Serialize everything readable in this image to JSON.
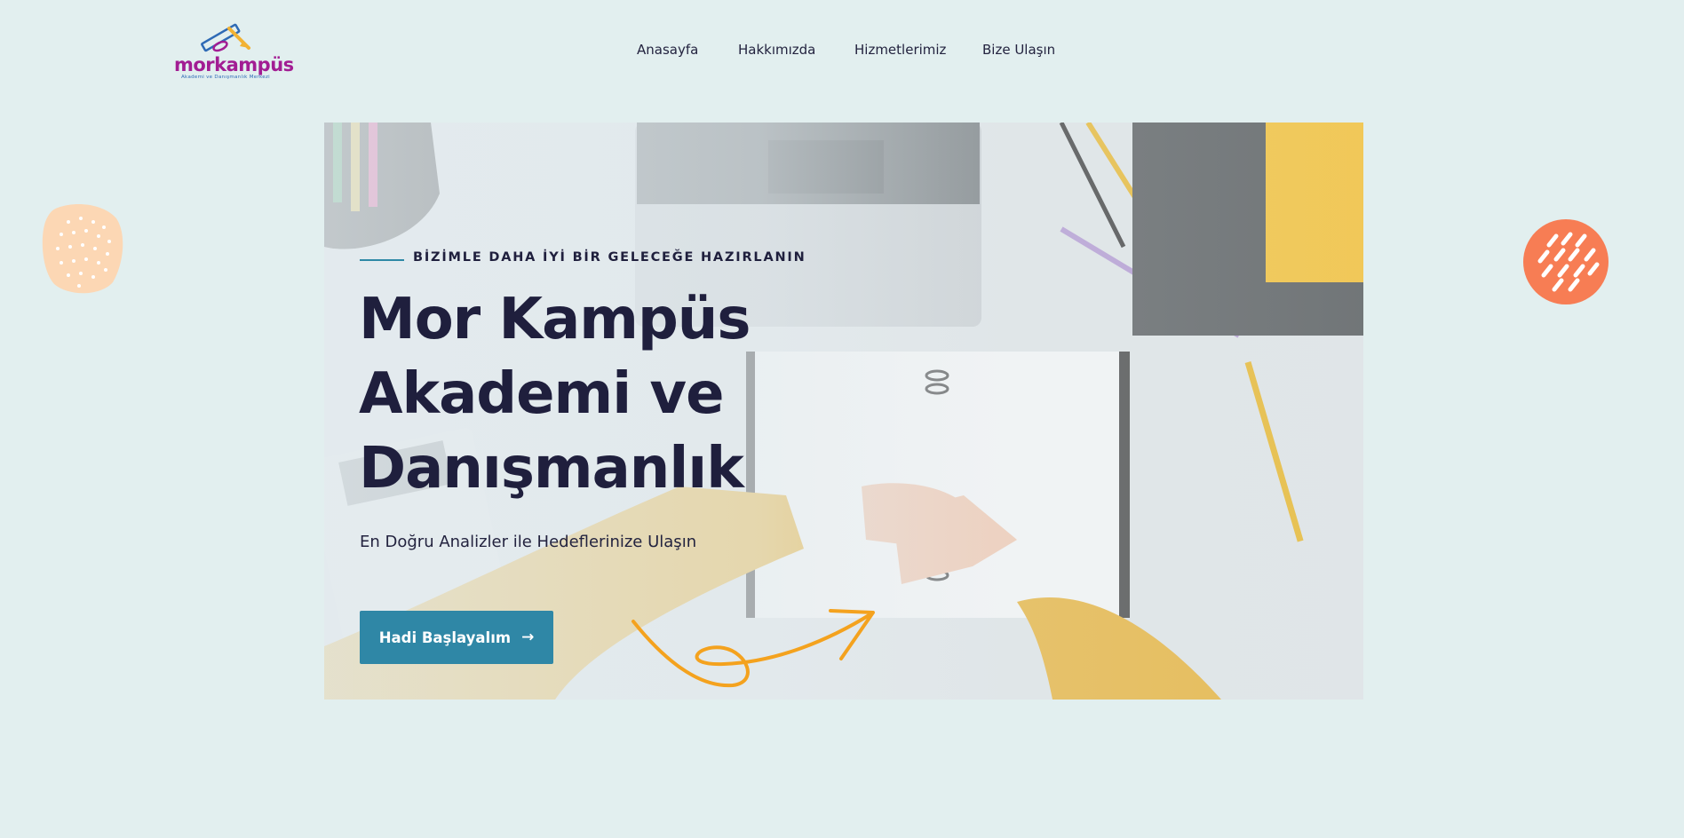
{
  "brand": {
    "name": "morkampüs",
    "tagline": "Akademi ve Danışmanlık Merkezi",
    "color": "#a21d93"
  },
  "nav": {
    "items": [
      "Anasayfa",
      "Hakkımızda",
      "Hizmetlerimiz",
      "Bize Ulaşın"
    ]
  },
  "hero": {
    "eyebrow": "BİZİMLE DAHA İYİ BİR GELECEĞE HAZIRLANIN",
    "title_lines": [
      "Mor Kampüs",
      "Akademi ve",
      "Danışmanlık"
    ],
    "subtitle": "En Doğru Analizler ile Hedeflerinize Ulaşın",
    "cta_label": "Hadi Başlayalım",
    "cta_icon": "arrow-right-icon",
    "accent_color": "#2f87a6",
    "title_color": "#1f1f3d"
  },
  "decor": {
    "left_blob_color": "#fcd7b4",
    "right_blob_color": "#f77d54",
    "squiggle_color": "#f4a21e"
  }
}
